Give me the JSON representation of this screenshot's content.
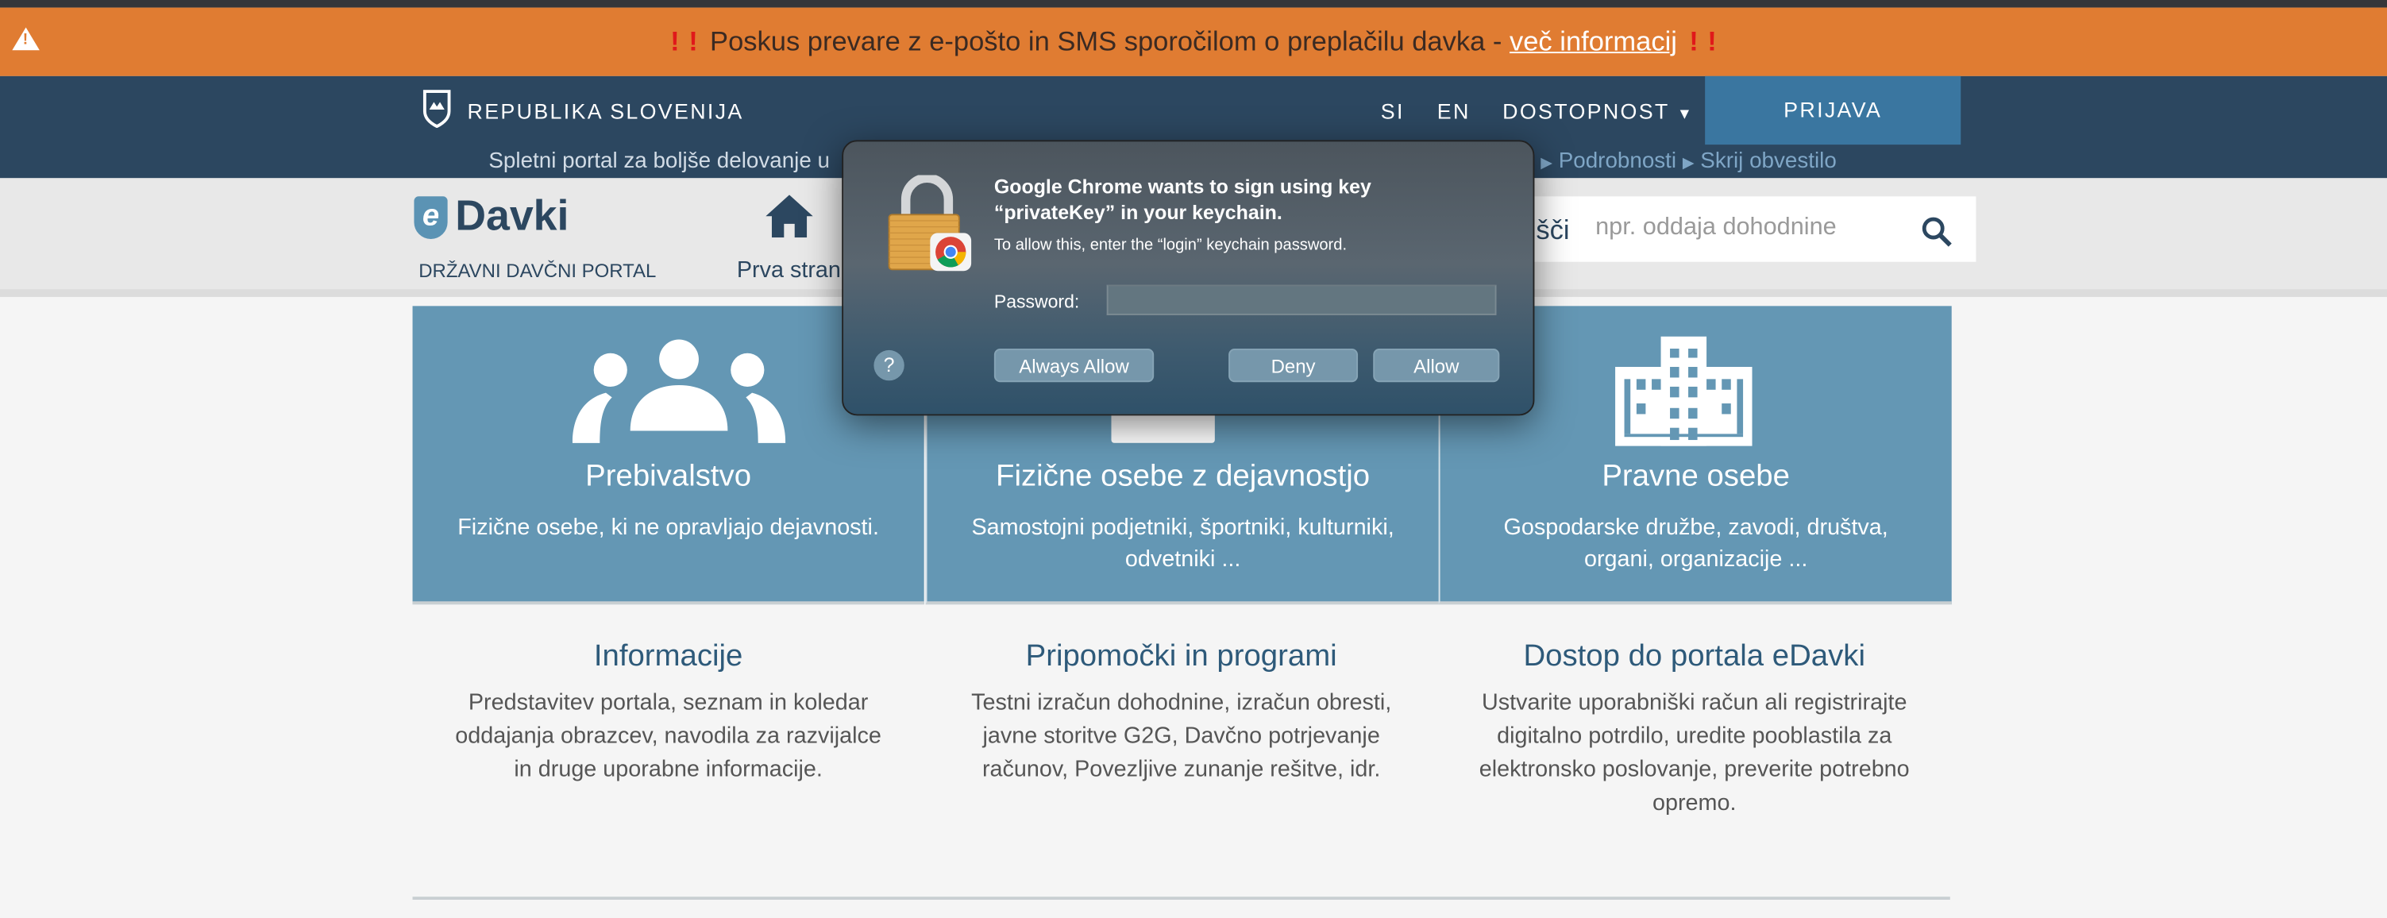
{
  "banner": {
    "bang": "!",
    "message": "Poskus prevare z e-pošto in SMS sporočilom o preplačilu davka - ",
    "link": "več informacij",
    "color": "#e07c32",
    "icon": "warning-triangle-icon"
  },
  "nav": {
    "brand": "REPUBLIKA SLOVENIJA",
    "lang_si": "SI",
    "lang_en": "EN",
    "accessibility": "DOSTOPNOST",
    "login": "PRIJAVA",
    "notice_start": "Spletni portal za boljše delovanje u",
    "notice_end": ".",
    "notice_more": "Podrobnosti",
    "notice_hide": "Skrij obvestilo"
  },
  "header": {
    "logo_e": "e",
    "logo": "Davki",
    "logo_sub": "DRŽAVNI DAVČNI PORTAL",
    "home": "Prva stran",
    "search_label": "šči",
    "search_placeholder": "npr. oddaja dohodnine"
  },
  "cards": [
    {
      "title": "Prebivalstvo",
      "desc": "Fizične osebe, ki ne opravljajo dejavnosti.",
      "icon": "people-icon"
    },
    {
      "title": "Fizične osebe z dejavnostjo",
      "desc": "Samostojni podjetniki, športniki, kulturniki, odvetniki ...",
      "icon": "computer-icon"
    },
    {
      "title": "Pravne osebe",
      "desc": "Gospodarske družbe, zavodi, društva, organi, organizacije ...",
      "icon": "building-icon"
    }
  ],
  "info": [
    {
      "title": "Informacije",
      "desc": "Predstavitev portala, seznam in koledar oddajanja obrazcev, navodila za razvijalce in druge uporabne informacije."
    },
    {
      "title": "Pripomočki in programi",
      "desc": "Testni izračun dohodnine, izračun obresti, javne storitve G2G, Davčno potrjevanje računov, Povezljive zunanje rešitve, idr."
    },
    {
      "title": "Dostop do portala eDavki",
      "desc": "Ustvarite uporabniški račun ali registrirajte digitalno potrdilo, uredite pooblastila za elektronsko poslovanje, preverite potrebno opremo."
    }
  ],
  "dialog": {
    "title": "Google Chrome wants to sign using key “privateKey” in your keychain.",
    "subtitle": "To allow this, enter the “login” keychain password.",
    "password_label": "Password:",
    "password_value": "",
    "help": "?",
    "always_allow": "Always Allow",
    "deny": "Deny",
    "allow": "Allow"
  }
}
